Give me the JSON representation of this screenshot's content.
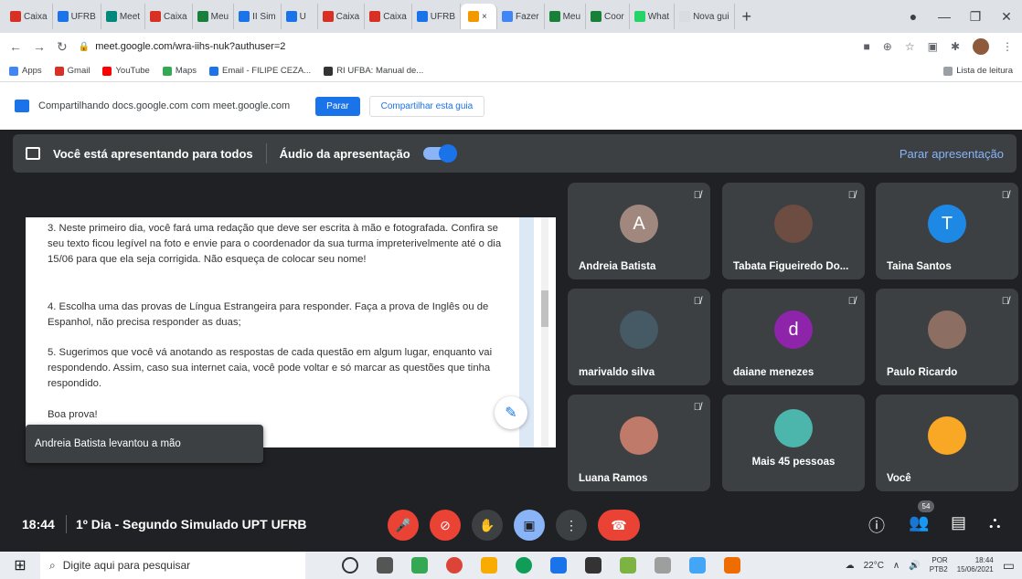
{
  "browser": {
    "tabs": [
      {
        "label": "Caixa",
        "favicon_color": "#d93025"
      },
      {
        "label": "UFRB",
        "favicon_color": "#1a73e8"
      },
      {
        "label": "Meet",
        "favicon_color": "#00897b"
      },
      {
        "label": "Caixa",
        "favicon_color": "#d93025"
      },
      {
        "label": "Meu",
        "favicon_color": "#188038"
      },
      {
        "label": "II Sim",
        "favicon_color": "#1a73e8"
      },
      {
        "label": "U",
        "favicon_color": "#1a73e8"
      },
      {
        "label": "Caixa",
        "favicon_color": "#d93025"
      },
      {
        "label": "Caixa",
        "favicon_color": "#d93025"
      },
      {
        "label": "UFRB",
        "favicon_color": "#1a73e8"
      },
      {
        "label": "×",
        "favicon_color": "#f29900"
      },
      {
        "label": "Fazer",
        "favicon_color": "#4285f4"
      },
      {
        "label": "Meu",
        "favicon_color": "#188038"
      },
      {
        "label": "Coor",
        "favicon_color": "#188038"
      },
      {
        "label": "What",
        "favicon_color": "#25d366"
      },
      {
        "label": "Nova gui",
        "favicon_color": "#dadce0"
      }
    ],
    "active_tab_index": 10,
    "new_tab": "+",
    "window_controls": [
      "—",
      "❐",
      "✕"
    ],
    "url": "meet.google.com/wra-iihs-nuk?authuser=2",
    "bookmarks": [
      {
        "label": "Apps",
        "color": "#4285f4"
      },
      {
        "label": "Gmail",
        "color": "#d93025"
      },
      {
        "label": "YouTube",
        "color": "#ff0000"
      },
      {
        "label": "Maps",
        "color": "#34a853"
      },
      {
        "label": "Email - FILIPE CEZA...",
        "color": "#1a73e8"
      },
      {
        "label": "RI UFBA: Manual de...",
        "color": "#333333"
      }
    ],
    "reading_list": "Lista de leitura"
  },
  "sharebar": {
    "text": "Compartilhando docs.google.com com meet.google.com",
    "stop_label": "Parar",
    "share_tab_label": "Compartilhar esta guia"
  },
  "presenting": {
    "status": "Você está apresentando para todos",
    "audio_label": "Áudio da apresentação",
    "stop_label": "Parar apresentação"
  },
  "document": {
    "paragraphs": [
      "3. Neste primeiro dia, você fará uma redação que deve ser escrita à mão e fotografada. Confira se seu texto ficou legível na foto e envie para o coordenador da sua turma impreterivelmente até o dia 15/06  para que ela seja corrigida. Não esqueça de colocar seu nome!",
      "4. Escolha uma das provas de Língua Estrangeira para responder. Faça a prova de Inglês ou de Espanhol, não precisa responder as duas;",
      "5. Sugerimos que você vá anotando as respostas de cada questão em algum lugar, enquanto vai respondendo. Assim, caso sua internet caia, você pode voltar e só marcar as questões que tinha respondido.",
      "Boa prova!"
    ]
  },
  "notification": "Andreia Batista levantou a mão",
  "participants": [
    {
      "name": "Andreia Batista",
      "initial": "A",
      "avatar_color": "#a1887f"
    },
    {
      "name": "Tabata Figueiredo Do...",
      "initial": "",
      "avatar_color": "#6d4c41"
    },
    {
      "name": "Taina Santos",
      "initial": "T",
      "avatar_color": "#1e88e5"
    },
    {
      "name": "marivaldo silva",
      "initial": "",
      "avatar_color": "#455a64"
    },
    {
      "name": "daiane menezes",
      "initial": "d",
      "avatar_color": "#8e24aa"
    },
    {
      "name": "Paulo Ricardo",
      "initial": "",
      "avatar_color": "#8d6e63"
    },
    {
      "name": "Luana Ramos",
      "initial": "",
      "avatar_color": "#bf7a6a"
    },
    {
      "name": "Mais 45 pessoas",
      "initial": "",
      "avatar_color": "#4db6ac"
    },
    {
      "name": "Você",
      "initial": "",
      "avatar_color": "#f9a825"
    }
  ],
  "bottombar": {
    "time": "18:44",
    "meeting_title": "1º Dia - Segundo Simulado UPT UFRB",
    "participant_count": "54"
  },
  "taskbar": {
    "search_placeholder": "Digite aqui para pesquisar",
    "temperature": "22°C",
    "language": "POR",
    "layout": "PTB2",
    "time": "18:44",
    "date": "15/06/2021"
  }
}
